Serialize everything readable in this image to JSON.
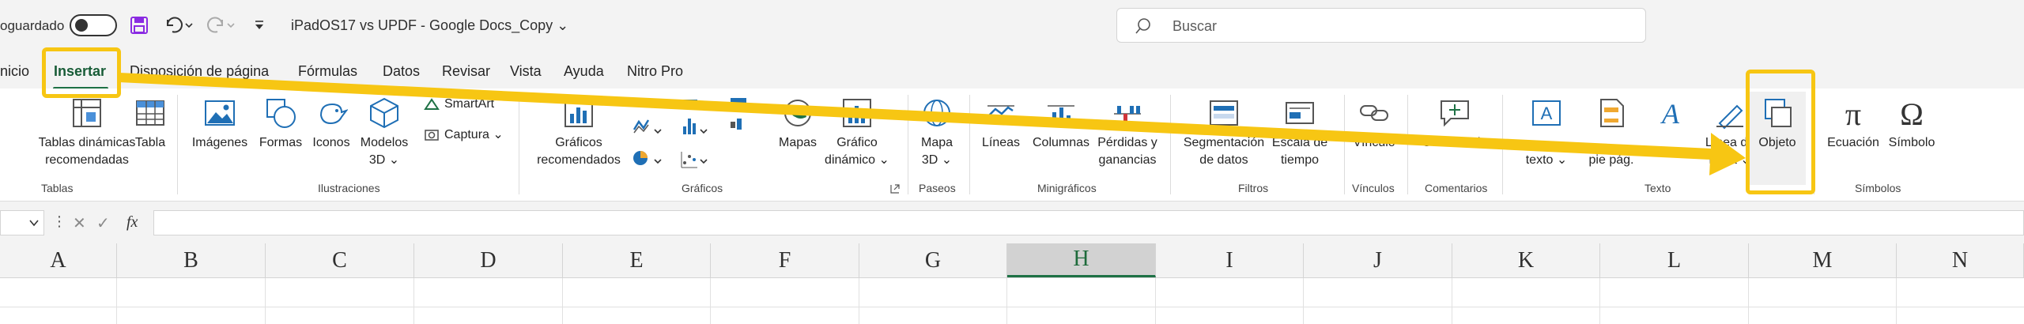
{
  "titlebar": {
    "autosave_label": "oguardado",
    "doc_title": "iPadOS17 vs UPDF - Google Docs_Copy ⌄",
    "search_placeholder": "Buscar"
  },
  "tabs": [
    "nicio",
    "Insertar",
    "Disposición de página",
    "Fórmulas",
    "Datos",
    "Revisar",
    "Vista",
    "Ayuda",
    "Nitro Pro"
  ],
  "ribbon": {
    "tablas": {
      "dinamicas": "Tablas dinámicas recomendadas",
      "tabla": "Tabla",
      "group": "Tablas"
    },
    "ilustraciones": {
      "imagenes": "Imágenes",
      "formas": "Formas",
      "iconos": "Iconos",
      "modelos": "Modelos 3D ⌄",
      "smartart": "SmartArt",
      "captura": "Captura ⌄",
      "group": "Ilustraciones"
    },
    "graficos": {
      "recomendados": "Gráficos recomendados",
      "mapas": "Mapas",
      "dinamico": "Gráfico dinámico ⌄",
      "group": "Gráficos"
    },
    "paseos": {
      "mapa3d": "Mapa 3D ⌄",
      "group": "Paseos"
    },
    "minigraficos": {
      "lineas": "Líneas",
      "columnas": "Columnas",
      "perdidas": "Pérdidas y ganancias",
      "group": "Minigráficos"
    },
    "filtros": {
      "segmentacion": "Segmentación de datos",
      "escala": "Escala de tiempo",
      "group": "Filtros"
    },
    "vinculos": {
      "vinculo": "Vínculo",
      "group": "Vínculos"
    },
    "comentarios": {
      "comentario": "Comentario",
      "group": "Comentarios"
    },
    "texto": {
      "cuadro": "texto ⌄",
      "piepag": "pie pág.",
      "linea_firma": "Línea de firma ⌄",
      "objeto": "Objeto",
      "group": "Texto"
    },
    "simbolos": {
      "ecuacion": "Ecuación",
      "simbolo": "Símbolo",
      "group": "Símbolos"
    }
  },
  "columns": [
    "A",
    "B",
    "C",
    "D",
    "E",
    "F",
    "G",
    "H",
    "I",
    "J",
    "K",
    "L",
    "M",
    "N"
  ],
  "selected_column": "H",
  "colors": {
    "accent": "#1e7145",
    "annotation": "#f7c613"
  }
}
